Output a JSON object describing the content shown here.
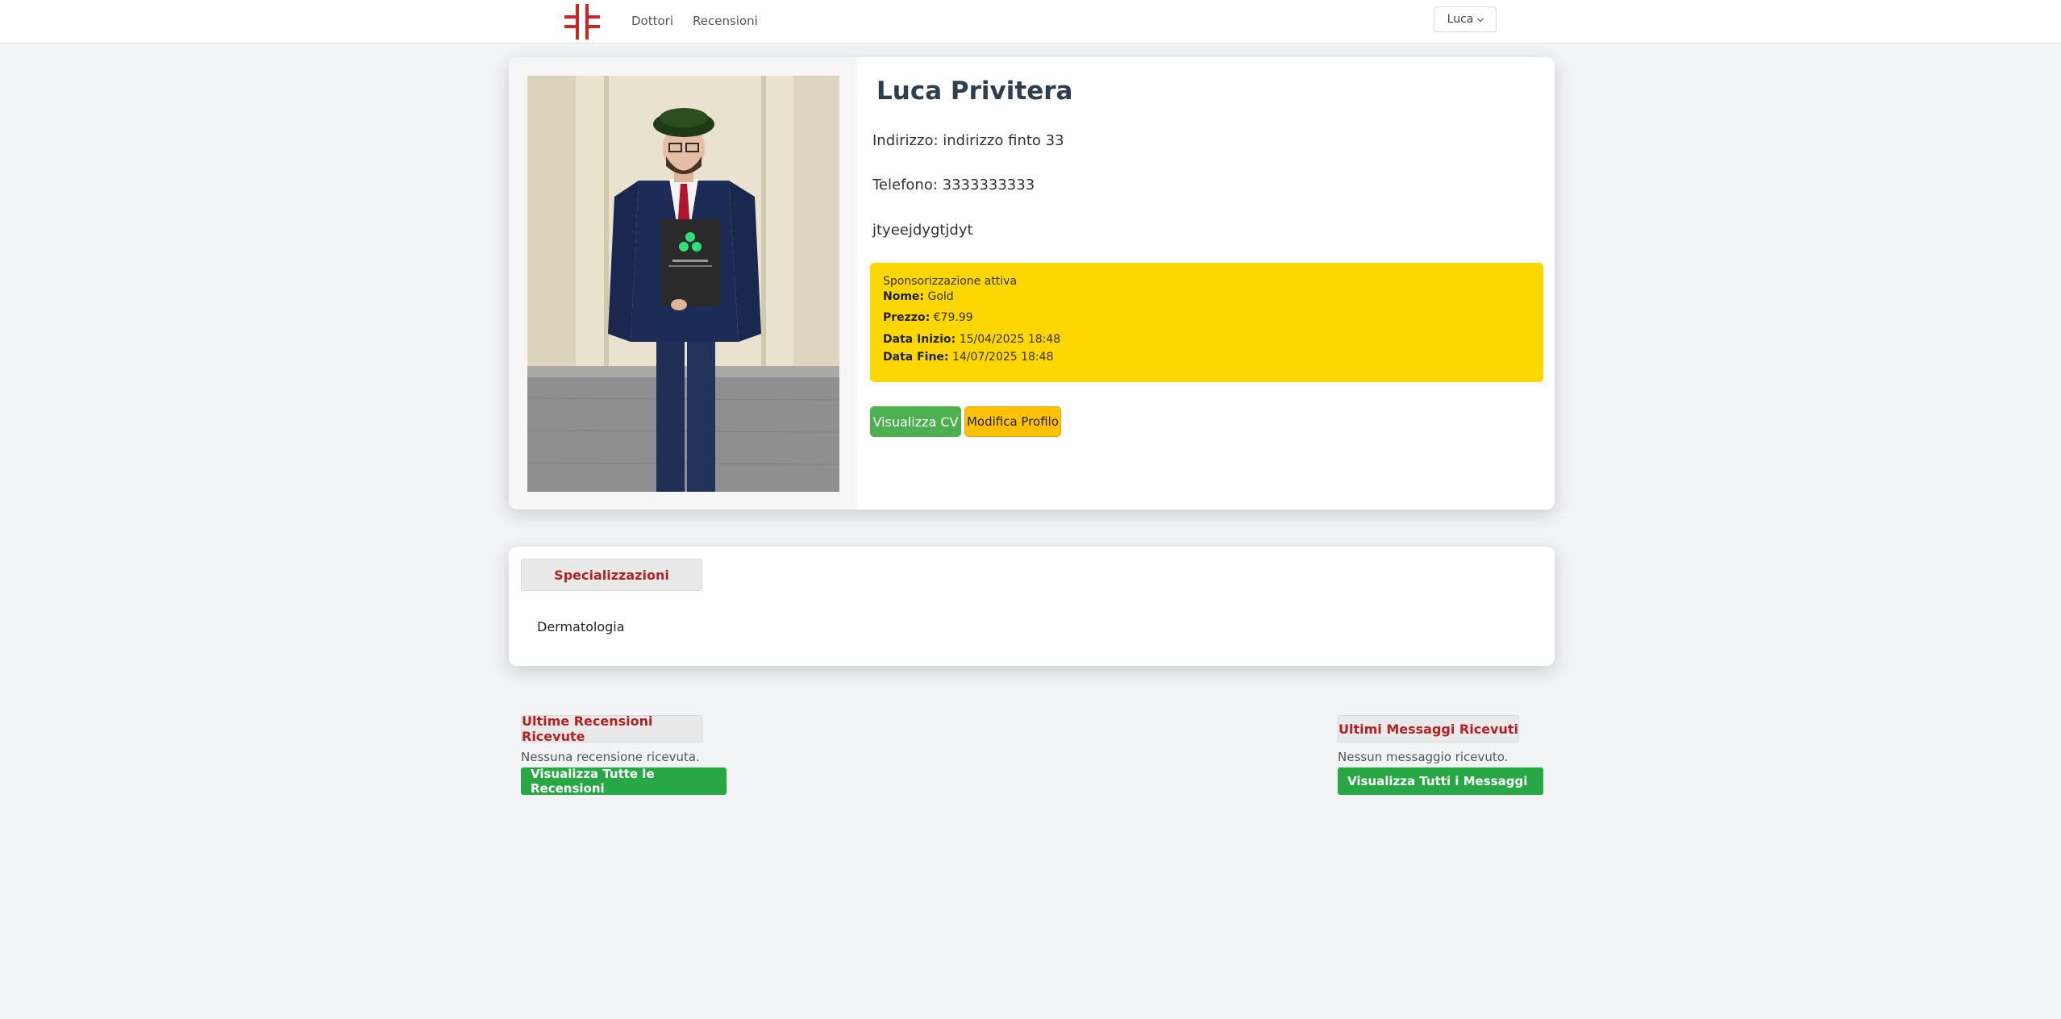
{
  "nav": {
    "links": [
      "Dottori",
      "Recensioni"
    ],
    "user_menu": "Luca"
  },
  "profile": {
    "name": "Luca Privitera",
    "address": "Indirizzo: indirizzo finto 33",
    "phone": "Telefono: 3333333333",
    "description": "jtyeejdygtjdyt",
    "sponsorship": {
      "title": "Sponsorizzazione attiva",
      "name_label": "Nome:",
      "name_value": "Gold",
      "price_label": "Prezzo:",
      "price_value": "€79.99",
      "start_label": "Data Inizio:",
      "start_value": "15/04/2025 18:48",
      "end_label": "Data Fine:",
      "end_value": "14/07/2025 18:48",
      "color": "#ffd700"
    },
    "buttons": {
      "cv": "Visualizza CV",
      "edit": "Modifica Profilo"
    }
  },
  "specializations": {
    "tab": "Specializzazioni",
    "items": [
      "Dermatologia"
    ]
  },
  "reviews": {
    "title": "Ultime Recensioni Ricevute",
    "empty": "Nessuna recensione ricevuta.",
    "button": "Visualizza Tutte le Recensioni"
  },
  "messages": {
    "title": "Ultimi Messaggi Ricevuti",
    "empty": "Nessun messaggio ricevuto.",
    "button": "Visualizza Tutti i Messaggi"
  },
  "colors": {
    "accent_red": "#b22222",
    "green": "#28a745",
    "gold": "#ffd700",
    "amber": "#ffc107"
  }
}
